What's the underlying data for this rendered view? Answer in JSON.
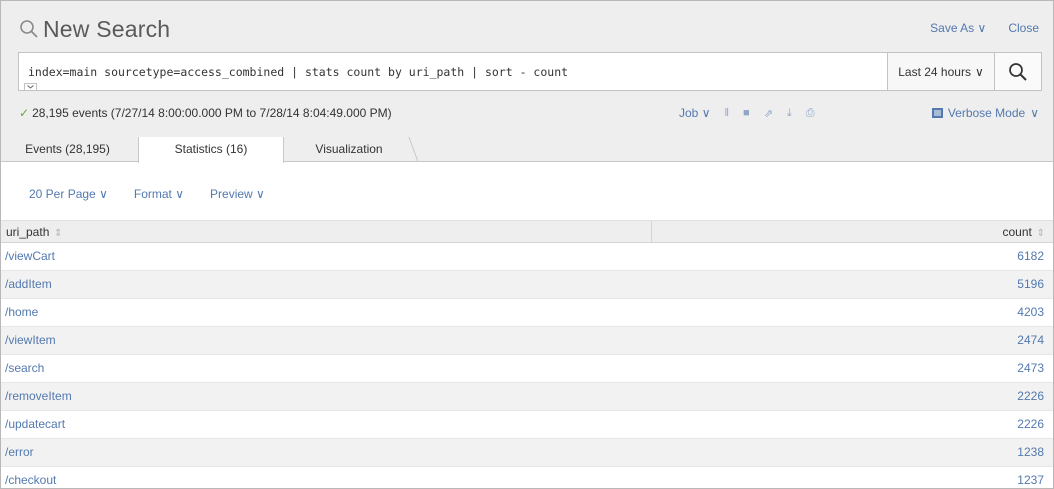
{
  "header": {
    "title": "New Search",
    "save_as": "Save As",
    "close": "Close"
  },
  "search": {
    "query": "index=main sourcetype=access_combined | stats count by uri_path | sort - count",
    "time_range": "Last 24 hours"
  },
  "status": {
    "summary": "28,195 events (7/27/14 8:00:00.000 PM to 7/28/14 8:04:49.000 PM)",
    "job_label": "Job",
    "mode_label": "Verbose Mode"
  },
  "tabs": [
    {
      "label": "Events (28,195)",
      "active": false
    },
    {
      "label": "Statistics (16)",
      "active": true
    },
    {
      "label": "Visualization",
      "active": false
    }
  ],
  "toolbar": {
    "per_page": "20 Per Page",
    "format": "Format",
    "preview": "Preview"
  },
  "table": {
    "columns": [
      "uri_path",
      "count"
    ],
    "rows": [
      {
        "uri_path": "/viewCart",
        "count": "6182"
      },
      {
        "uri_path": "/addItem",
        "count": "5196"
      },
      {
        "uri_path": "/home",
        "count": "4203"
      },
      {
        "uri_path": "/viewItem",
        "count": "2474"
      },
      {
        "uri_path": "/search",
        "count": "2473"
      },
      {
        "uri_path": "/removeItem",
        "count": "2226"
      },
      {
        "uri_path": "/updatecart",
        "count": "2226"
      },
      {
        "uri_path": "/error",
        "count": "1238"
      },
      {
        "uri_path": "/checkout",
        "count": "1237"
      }
    ]
  },
  "colors": {
    "link": "#5379af",
    "success": "#65a637",
    "header_bg": "#eeeeee"
  }
}
